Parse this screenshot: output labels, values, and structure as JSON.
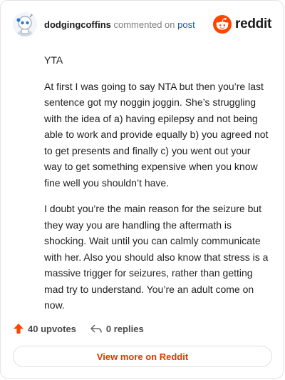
{
  "header": {
    "username": "dodgingcoffins",
    "action": "commented on",
    "link_text": "post",
    "brand": "reddit"
  },
  "comment": {
    "paragraphs": [
      "YTA",
      "At first I was going to say NTA but then you’re last sentence got my noggin joggin. She’s struggling with the idea of a) having epilepsy and not being able to work and provide equally b) you agreed not to get presents and finally c) you went out your way to get something expensive when you know fine well you shouldn’t have.",
      "I doubt you’re the main reason for the seizure but they way you are handling the aftermath is shocking. Wait until you can calmly communicate with her. Also you should also know that stress is a massive trigger for seizures, rather than getting mad try to understand. You’re an adult come on now."
    ]
  },
  "stats": {
    "upvotes": "40 upvotes",
    "replies": "0 replies"
  },
  "footer": {
    "view_more": "View more on Reddit"
  },
  "colors": {
    "accent": "#d93a00",
    "upvote": "#ff4500",
    "link": "#0f5fb0"
  },
  "icons": {
    "avatar": "robot-avatar",
    "brand": "reddit-logo-icon",
    "upvote": "upvote-arrow-icon",
    "reply": "reply-arrow-icon"
  }
}
